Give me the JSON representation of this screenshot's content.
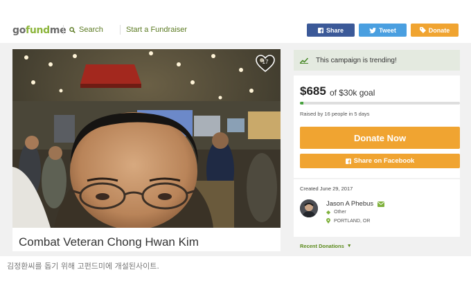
{
  "header": {
    "logo": {
      "part1": "go",
      "part2": "fund",
      "part3": "me"
    },
    "search_label": "Search",
    "start_label": "Start a Fundraiser",
    "share_label": "Share",
    "tweet_label": "Tweet",
    "donate_label": "Donate"
  },
  "campaign": {
    "title": "Combat Veteran Chong Hwan Kim",
    "heart_count": "17",
    "trending_text": "This campaign is trending!",
    "amount": "$685",
    "goal_text": "of $30k goal",
    "progress_fraction": 0.023,
    "raised_text": "Raised by 16 people in 5 days",
    "donate_now_label": "Donate Now",
    "share_facebook_label": "Share on Facebook",
    "created_text": "Created June 29, 2017",
    "organizer": {
      "name": "Jason A Phebus",
      "category": "Other",
      "location": "PORTLAND, OR"
    },
    "recent_donations_label": "Recent Donations"
  },
  "caption": "김정환씨를 돕기 위해 고펀드미에 개설된사이트.",
  "colors": {
    "brand_green": "#8cb53b",
    "facebook_blue": "#3b5998",
    "twitter_blue": "#4a9fe0",
    "donate_orange": "#f0a431",
    "progress_green": "#48a23f"
  }
}
